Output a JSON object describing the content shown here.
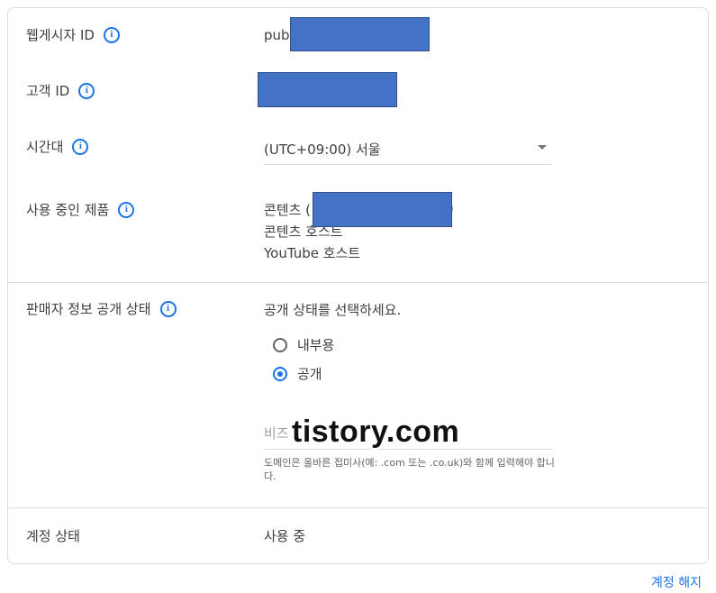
{
  "fields": {
    "publisher_id": {
      "label": "웹게시자 ID",
      "value_prefix": "pub-"
    },
    "customer_id": {
      "label": "고객 ID"
    },
    "timezone": {
      "label": "시간대",
      "value": "(UTC+09:00) 서울"
    },
    "products": {
      "label": "사용 중인 제품",
      "items": [
        "콘텐츠 (",
        "콘텐츠 호스트",
        "YouTube 호스트"
      ],
      "item0_suffix": ")"
    },
    "seller_info": {
      "label": "판매자 정보 공개 상태",
      "prompt": "공개 상태를 선택하세요.",
      "options": [
        {
          "label": "내부용",
          "selected": false
        },
        {
          "label": "공개",
          "selected": true
        }
      ],
      "domain_placeholder": "비즈",
      "hint": "도메인은 올바른 접미사(예: .com 또는 .co.uk)와 함께 입력해야 합니다."
    },
    "account_status": {
      "label": "계정 상태",
      "value": "사용 중"
    }
  },
  "watermark": "tistory.com",
  "footer": {
    "close_account_label": "계정 해지"
  },
  "colors": {
    "accent": "#1a73e8",
    "redaction": "#4472c4",
    "border": "#dadce0"
  },
  "icons": {
    "info": "info-icon",
    "dropdown": "chevron-down-icon"
  }
}
